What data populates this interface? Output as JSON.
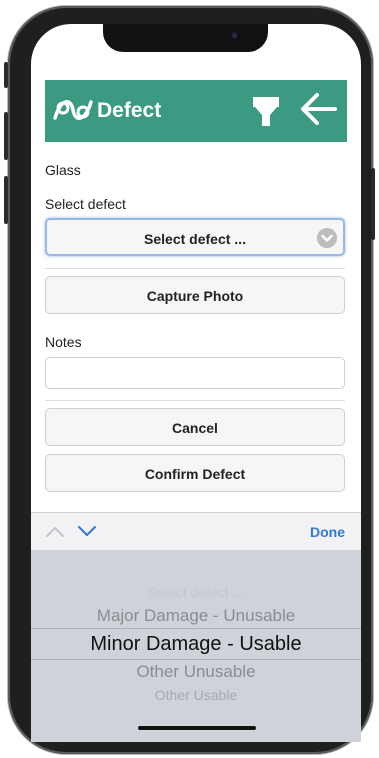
{
  "header": {
    "title": "Defect"
  },
  "form": {
    "component_label": "Glass",
    "select_defect_label": "Select defect",
    "select_defect_value": "Select defect ...",
    "capture_photo_label": "Capture Photo",
    "notes_label": "Notes",
    "notes_value": "",
    "cancel_label": "Cancel",
    "confirm_label": "Confirm Defect"
  },
  "toolbar": {
    "done_label": "Done"
  },
  "picker": {
    "options": [
      "Select defect ...",
      "Major Damage - Unusable",
      "Minor Damage - Usable",
      "Other Unusable",
      "Other Usable"
    ],
    "selected": "Minor Damage - Usable"
  },
  "colors": {
    "header_bg": "#3c9a83",
    "done": "#2f7ad9"
  },
  "icons": [
    "logo-icon",
    "filter-icon",
    "back-arrow-icon",
    "chevron-down-icon",
    "chevron-up-icon"
  ]
}
